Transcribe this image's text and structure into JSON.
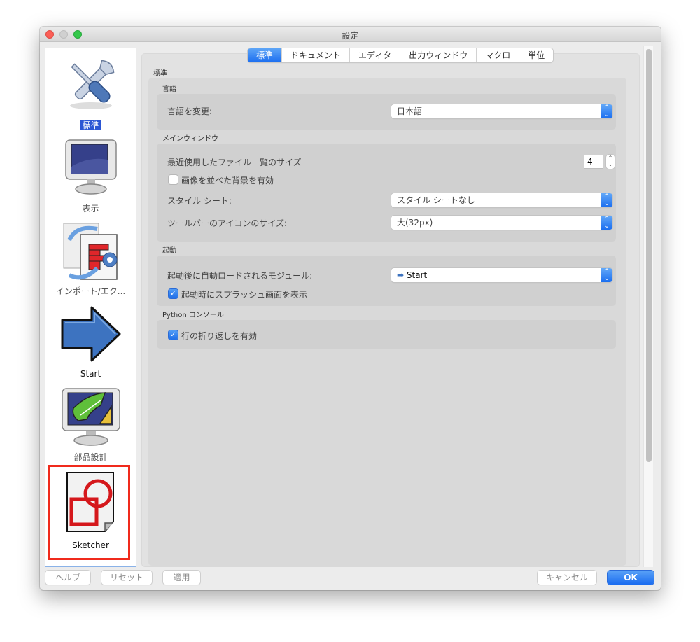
{
  "window": {
    "title": "設定"
  },
  "sidebar": {
    "items": [
      {
        "label": "標準",
        "icon": "tools-icon",
        "selected": true
      },
      {
        "label": "表示",
        "icon": "monitor-icon",
        "selected": false
      },
      {
        "label": "インポート/エク...",
        "icon": "import-export-icon",
        "selected": false
      },
      {
        "label": "Start",
        "icon": "arrow-right-icon",
        "selected": false
      },
      {
        "label": "部品設計",
        "icon": "part-design-icon",
        "selected": false
      },
      {
        "label": "Sketcher",
        "icon": "sketcher-icon",
        "selected": false,
        "highlighted": true
      }
    ]
  },
  "tabs": [
    {
      "label": "標準",
      "active": true
    },
    {
      "label": "ドキュメント",
      "active": false
    },
    {
      "label": "エディタ",
      "active": false
    },
    {
      "label": "出力ウィンドウ",
      "active": false
    },
    {
      "label": "マクロ",
      "active": false
    },
    {
      "label": "単位",
      "active": false
    }
  ],
  "page": {
    "title": "標準",
    "groups": {
      "language": {
        "title": "言語",
        "change_language_label": "言語を変更:",
        "change_language_value": "日本語"
      },
      "main_window": {
        "title": "メインウィンドウ",
        "recent_files_label": "最近使用したファイル一覧のサイズ",
        "recent_files_value": "4",
        "tiled_background_label": "画像を並べた背景を有効",
        "tiled_background_checked": false,
        "style_sheet_label": "スタイル シート:",
        "style_sheet_value": "スタイル シートなし",
        "toolbar_icon_size_label": "ツールバーのアイコンのサイズ:",
        "toolbar_icon_size_value": "大(32px)"
      },
      "startup": {
        "title": "起動",
        "autoload_module_label": "起動後に自動ロードされるモジュール:",
        "autoload_module_value": "Start",
        "splash_label": "起動時にスプラッシュ画面を表示",
        "splash_checked": true
      },
      "python_console": {
        "title": "Python コンソール",
        "word_wrap_label": "行の折り返しを有効",
        "word_wrap_checked": true
      }
    }
  },
  "buttons": {
    "help": "ヘルプ",
    "reset": "リセット",
    "apply": "適用",
    "cancel": "キャンセル",
    "ok": "OK"
  },
  "colors": {
    "accent": "#1b6ef0",
    "highlight_box": "#f02a1c",
    "selected_label_bg": "#2b56d4"
  }
}
